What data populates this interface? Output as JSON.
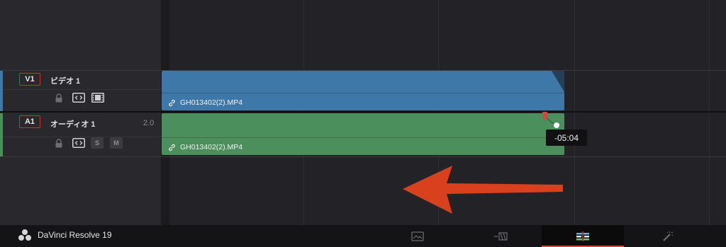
{
  "app": {
    "name": "DaVinci Resolve 19"
  },
  "tracks": [
    {
      "id": "V1",
      "name": "ビデオ 1",
      "kind": "video"
    },
    {
      "id": "A1",
      "name": "オーディオ 1",
      "kind": "audio",
      "channel": "2.0",
      "solo_label": "S",
      "mute_label": "M"
    }
  ],
  "clips": {
    "video": {
      "name": "GH013402(2).MP4",
      "color": "#3e78a8"
    },
    "audio": {
      "name": "GH013402(2).MP4",
      "color": "#4a8f5c"
    }
  },
  "tooltip": {
    "text": "-05:04"
  },
  "colors": {
    "arrow": "#d9411e",
    "active_tab": "#e0442a",
    "track_badge_border": "#c0392b"
  },
  "page_tabs": [
    {
      "name": "media-page-icon",
      "active": false
    },
    {
      "name": "cut-page-icon",
      "active": false
    },
    {
      "name": "edit-page-icon",
      "active": true
    },
    {
      "name": "fusion-page-icon",
      "active": false
    }
  ]
}
